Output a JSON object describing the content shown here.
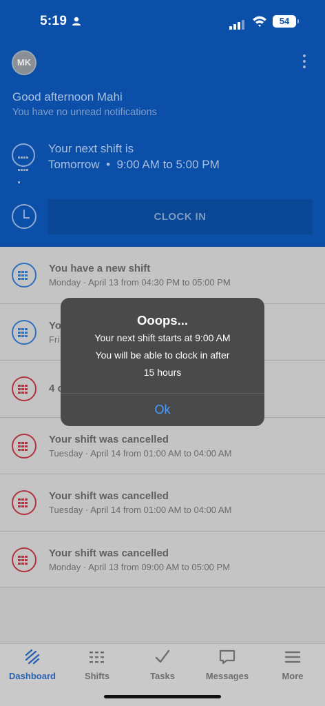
{
  "status": {
    "time": "5:19",
    "battery": "54"
  },
  "header": {
    "avatar_initials": "MK",
    "greeting": "Good afternoon Mahi",
    "notifications": "You have no unread notifications",
    "next_shift_label": "Your next shift is",
    "next_shift_time": "Tomorrow  •  9:00 AM to 5:00 PM",
    "clock_in_label": "CLOCK IN"
  },
  "list": {
    "items": [
      {
        "title": "You have a new shift",
        "subtitle": "Monday · April 13 from 04:30 PM to 05:00 PM",
        "color": "blue"
      },
      {
        "title": "You",
        "subtitle": "Fri",
        "color": "blue"
      },
      {
        "title": "4 c",
        "subtitle": "",
        "color": "red"
      },
      {
        "title": "Your shift was cancelled",
        "subtitle": "Tuesday · April 14 from 01:00 AM to 04:00 AM",
        "color": "red"
      },
      {
        "title": "Your shift was cancelled",
        "subtitle": "Tuesday · April 14 from 01:00 AM to 04:00 AM",
        "color": "red"
      },
      {
        "title": "Your shift was cancelled",
        "subtitle": "Monday · April 13 from 09:00 AM to 05:00 PM",
        "color": "red"
      }
    ]
  },
  "dialog": {
    "title": "Ooops...",
    "line1": "Your next shift starts at 9:00 AM",
    "line2": "You will be able to clock in after",
    "line3": "15 hours",
    "ok_label": "Ok"
  },
  "tabbar": {
    "dashboard": "Dashboard",
    "shifts": "Shifts",
    "tasks": "Tasks",
    "messages": "Messages",
    "more": "More"
  },
  "colors": {
    "header_blue": "#0b4fa8",
    "accent": "#2b62b0",
    "cancel_red": "#b0333f",
    "dialog_ok": "#4a9bff"
  }
}
